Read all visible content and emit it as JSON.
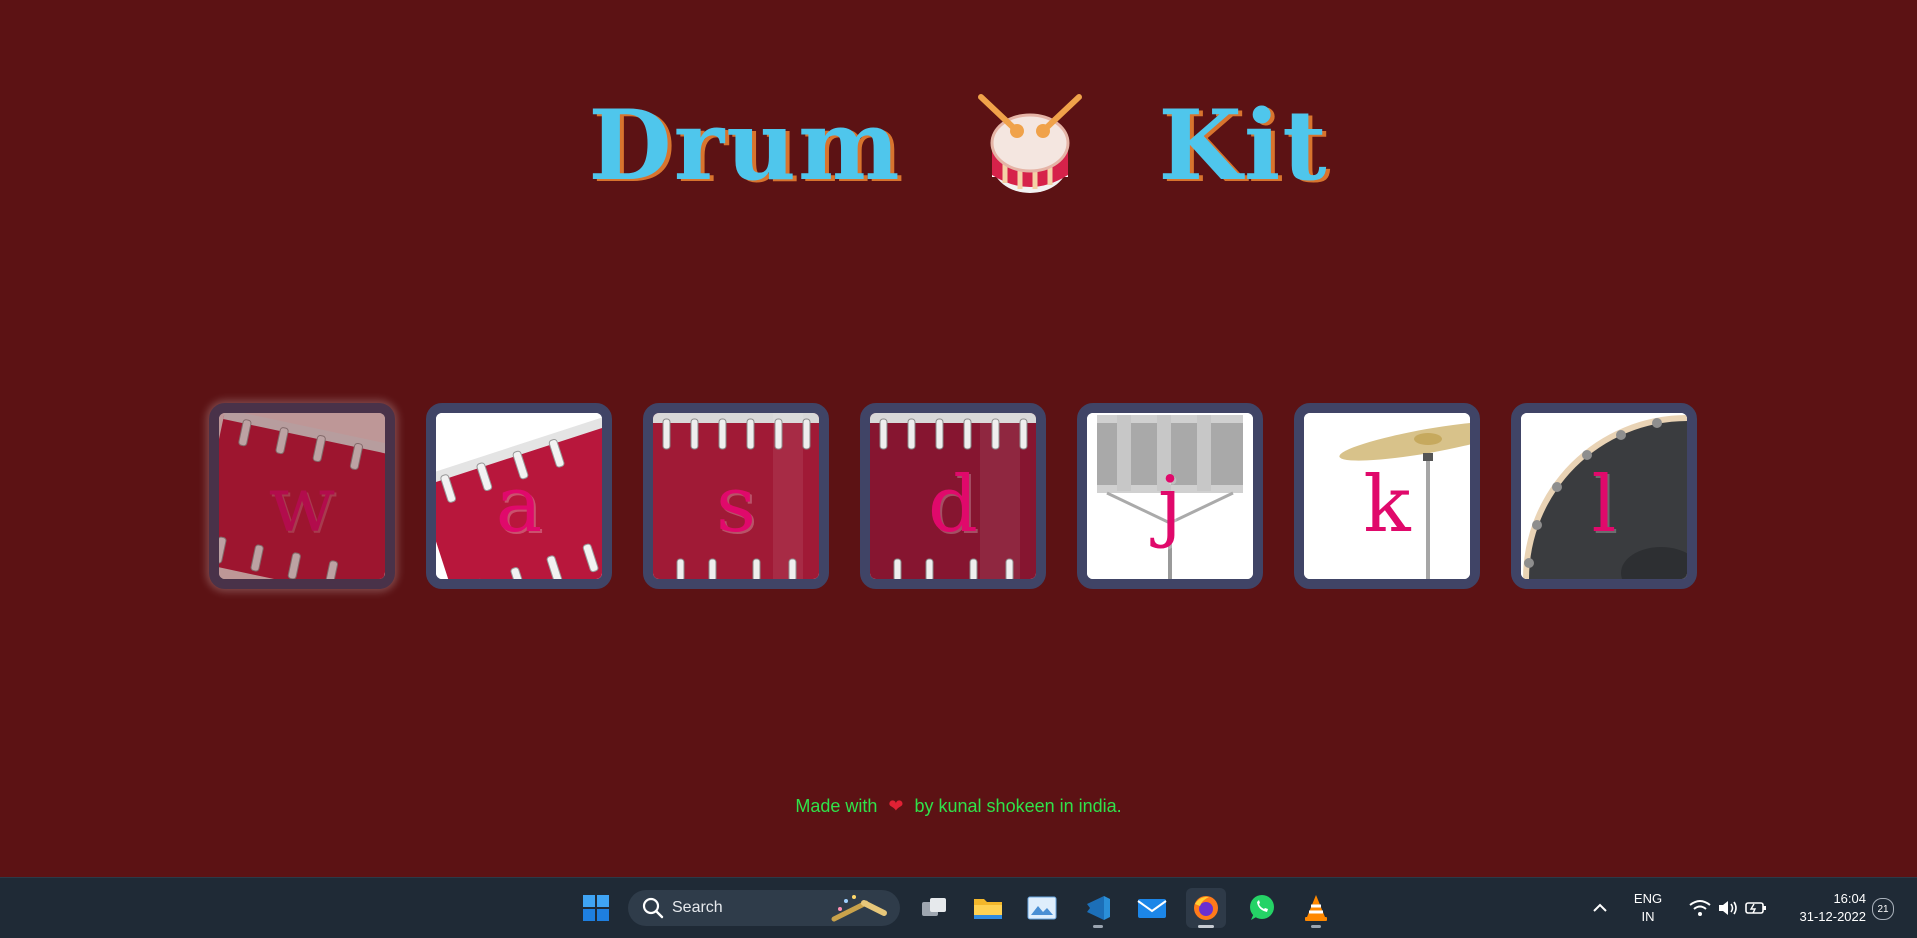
{
  "title": {
    "left": "Drum",
    "right": "Kit",
    "emoji_icon": "drum-emoji-icon"
  },
  "pads": [
    {
      "key": "w",
      "sound": "tom-1",
      "pressed": true
    },
    {
      "key": "a",
      "sound": "tom-2",
      "pressed": false
    },
    {
      "key": "s",
      "sound": "tom-3",
      "pressed": false
    },
    {
      "key": "d",
      "sound": "tom-4",
      "pressed": false
    },
    {
      "key": "j",
      "sound": "snare",
      "pressed": false
    },
    {
      "key": "k",
      "sound": "crash",
      "pressed": false
    },
    {
      "key": "l",
      "sound": "kick",
      "pressed": false
    }
  ],
  "footer": {
    "before": "Made with",
    "after": "by kunal shokeen in india."
  },
  "taskbar": {
    "search_placeholder": "Search",
    "apps": [
      "start-icon",
      "search-box",
      "task-view-icon",
      "file-explorer-icon",
      "photos-icon",
      "vscode-icon",
      "mail-icon",
      "firefox-icon",
      "whatsapp-icon",
      "vlc-icon"
    ],
    "language_line1": "ENG",
    "language_line2": "IN",
    "time": "16:04",
    "date": "31-12-2022",
    "notification_count": "21"
  },
  "colors": {
    "background": "#5c1214",
    "title": "#4fc6ec",
    "title_shadow": "#d8742e",
    "key_letter": "#e0096b",
    "pad_border": "#404466",
    "footer_text": "#30e24a"
  }
}
